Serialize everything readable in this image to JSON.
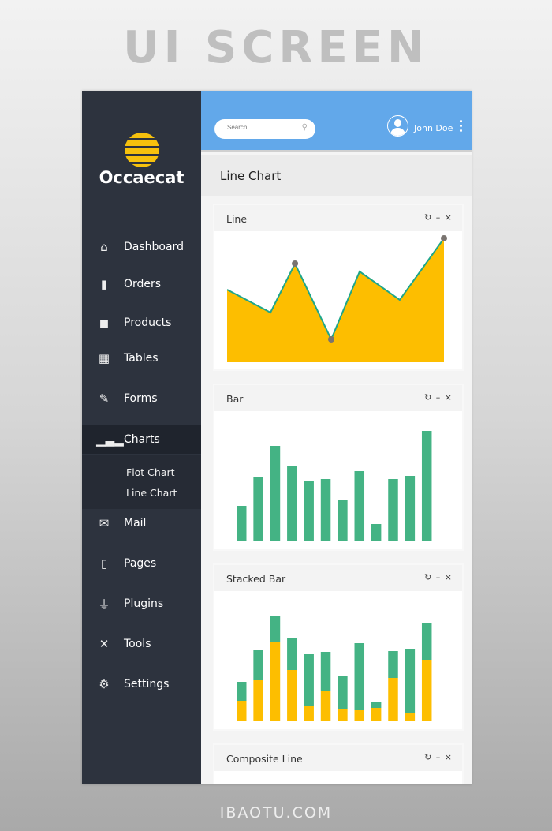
{
  "banner": {
    "title": "UI SCREEN",
    "footer": "IBAOTU.COM"
  },
  "sidebar": {
    "brand": "Occaecat",
    "items": [
      {
        "label": "Dashboard",
        "icon": "home-icon",
        "glyph": "⌂"
      },
      {
        "label": "Orders",
        "icon": "tag-icon",
        "glyph": "▮"
      },
      {
        "label": "Products",
        "icon": "box-icon",
        "glyph": "◼"
      },
      {
        "label": "Tables",
        "icon": "grid-icon",
        "glyph": "▦"
      },
      {
        "label": "Forms",
        "icon": "edit-icon",
        "glyph": "✎"
      },
      {
        "label": "Charts",
        "icon": "bar-chart-icon",
        "glyph": "▁▃▂"
      },
      {
        "label": "Mail",
        "icon": "mail-icon",
        "glyph": "✉"
      },
      {
        "label": "Pages",
        "icon": "page-icon",
        "glyph": "▯"
      },
      {
        "label": "Plugins",
        "icon": "plug-icon",
        "glyph": "⏚"
      },
      {
        "label": "Tools",
        "icon": "tools-icon",
        "glyph": "✕"
      },
      {
        "label": "Settings",
        "icon": "gear-icon",
        "glyph": "⚙"
      }
    ],
    "active": "Charts",
    "submenu": [
      "Flot Chart",
      "Line Chart"
    ]
  },
  "header": {
    "search_placeholder": "Search...",
    "user": "John Doe"
  },
  "page": {
    "title": "Line Chart"
  },
  "cards": [
    {
      "title": "Line",
      "tools": "↻ – ×"
    },
    {
      "title": "Bar",
      "tools": "↻ – ×"
    },
    {
      "title": "Stacked Bar",
      "tools": "↻ – ×"
    },
    {
      "title": "Composite Line",
      "tools": "↻ – ×"
    }
  ],
  "colors": {
    "blue": "#62a8ea",
    "yellow": "#fdbe00",
    "green": "#44b384",
    "sidebar": "#2d333e",
    "marker": "#7a7470"
  },
  "chart_data": [
    {
      "type": "area",
      "title": "Line",
      "values": [
        92,
        63,
        125,
        29,
        115,
        79,
        157
      ],
      "markers_at": [
        2,
        3,
        6
      ],
      "grid": false
    },
    {
      "type": "bar",
      "title": "Bar",
      "values": [
        45,
        82,
        121,
        96,
        76,
        79,
        52,
        89,
        22,
        79,
        83,
        140
      ],
      "grid": false
    },
    {
      "type": "bar",
      "title": "Stacked Bar",
      "stacked": true,
      "series": [
        {
          "color": "#fdbe00",
          "values": [
            26,
            52,
            100,
            65,
            19,
            38,
            16,
            14,
            17,
            55,
            11,
            78
          ]
        },
        {
          "color": "#44b384",
          "values": [
            24,
            38,
            34,
            41,
            66,
            50,
            42,
            85,
            8,
            34,
            81,
            46
          ]
        }
      ],
      "grid": false
    }
  ]
}
